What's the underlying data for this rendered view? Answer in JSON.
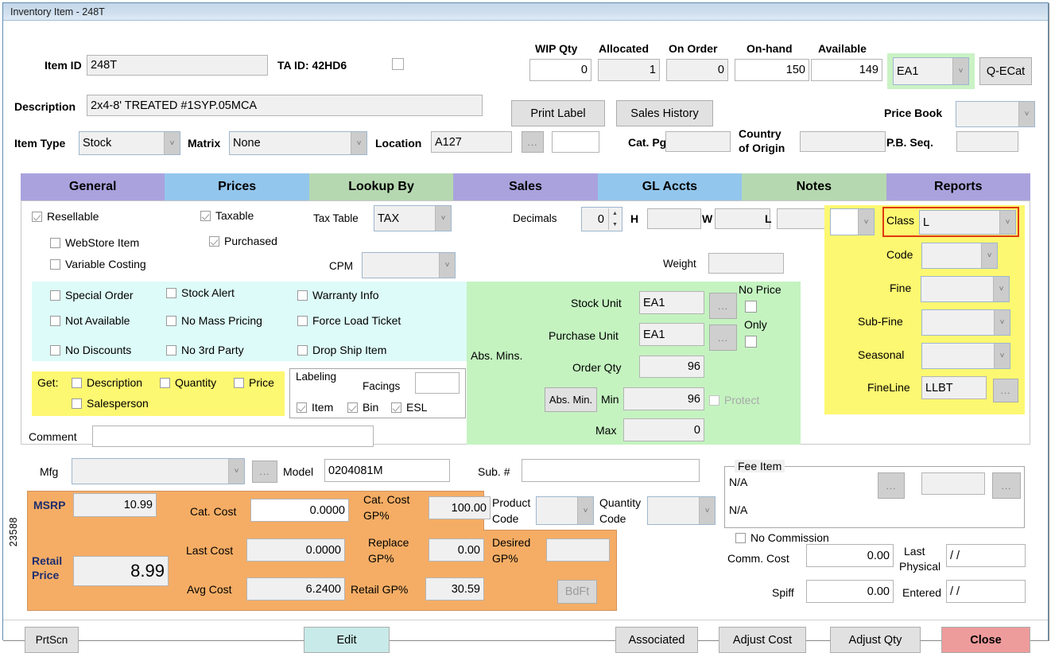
{
  "window": {
    "title": "Inventory Item - 248T",
    "record_tag": "23588"
  },
  "header": {
    "item_id_label": "Item ID",
    "item_id_value": "248T",
    "ta_id_label": "TA ID: 42HD6",
    "description_label": "Description",
    "description_value": "2x4-8' TREATED #1SYP.05MCA",
    "item_type_label": "Item Type",
    "item_type_value": "Stock",
    "matrix_label": "Matrix",
    "matrix_value": "None",
    "location_label": "Location",
    "location_value": "A127",
    "ellipsis_label": "...",
    "extra_value": "",
    "cat_pg_label": "Cat. Pg.",
    "cat_pg_value": "",
    "country_label_line1": "Country",
    "country_label_line2": "of Origin",
    "country_value": "",
    "price_book_label": "Price Book",
    "price_book_value": "",
    "pb_seq_label": "P.B. Seq.",
    "pb_seq_value": ""
  },
  "quantities": [
    {
      "label": "WIP Qty",
      "value": "0",
      "editable": true
    },
    {
      "label": "Allocated",
      "value": "1",
      "editable": false
    },
    {
      "label": "On Order",
      "value": "0",
      "editable": false
    },
    {
      "label": "On-hand",
      "value": "150",
      "editable": false
    },
    {
      "label": "Available",
      "value": "149",
      "editable": false
    }
  ],
  "unit_selector": {
    "value": "EA1"
  },
  "buttons": {
    "qecat": "Q-ECat",
    "print_label": "Print Label",
    "sales_history": "Sales History",
    "prtscn": "PrtScn",
    "edit": "Edit",
    "associated": "Associated",
    "adjust_cost": "Adjust Cost",
    "adjust_qty": "Adjust Qty",
    "close": "Close",
    "abs_min": "Abs. Min.",
    "bdft": "BdFt",
    "ellipsis": "..."
  },
  "tabs": [
    {
      "label": "General",
      "color": "purple",
      "active": true
    },
    {
      "label": "Prices",
      "color": "blue",
      "active": false
    },
    {
      "label": "Lookup By",
      "color": "green",
      "active": false
    },
    {
      "label": "Sales",
      "color": "purple",
      "active": false
    },
    {
      "label": "GL Accts",
      "color": "blue",
      "active": false
    },
    {
      "label": "Notes",
      "color": "green",
      "active": false
    },
    {
      "label": "Reports",
      "color": "purple",
      "active": false
    }
  ],
  "general": {
    "resellable": {
      "label": "Resellable",
      "checked": true
    },
    "webstore_item": {
      "label": "WebStore Item",
      "checked": false
    },
    "variable_costing": {
      "label": "Variable Costing",
      "checked": false
    },
    "taxable": {
      "label": "Taxable",
      "checked": true
    },
    "purchased": {
      "label": "Purchased",
      "checked": true
    },
    "tax_table_label": "Tax Table",
    "tax_table_value": "TAX",
    "cpm_label": "CPM",
    "cpm_value": "",
    "decimals_label": "Decimals",
    "decimals_value": "0",
    "h_label": "H",
    "h_value": "",
    "w_label": "W",
    "w_value": "",
    "l_label": "L",
    "l_value": "",
    "weight_label": "Weight",
    "weight_value": ""
  },
  "flags_panel": [
    {
      "label": "Special Order",
      "checked": false
    },
    {
      "label": "Stock Alert",
      "checked": false
    },
    {
      "label": "Warranty Info",
      "checked": false
    },
    {
      "label": "Not Available",
      "checked": false
    },
    {
      "label": "No Mass Pricing",
      "checked": false
    },
    {
      "label": "Force Load Ticket",
      "checked": false
    },
    {
      "label": "No Discounts",
      "checked": false
    },
    {
      "label": "No 3rd Party",
      "checked": false
    },
    {
      "label": "Drop Ship Item",
      "checked": false
    }
  ],
  "get_panel": {
    "title": "Get:",
    "items": [
      {
        "label": "Description",
        "checked": false
      },
      {
        "label": "Quantity",
        "checked": false
      },
      {
        "label": "Price",
        "checked": false
      },
      {
        "label": "Salesperson",
        "checked": false
      }
    ]
  },
  "labeling": {
    "caption": "Labeling",
    "facings_label": "Facings",
    "facings_value": "",
    "item": {
      "label": "Item",
      "checked": true
    },
    "bin": {
      "label": "Bin",
      "checked": true
    },
    "esl": {
      "label": "ESL",
      "checked": true
    }
  },
  "comment": {
    "label": "Comment",
    "value": ""
  },
  "units": {
    "abs_mins_label": "Abs. Mins.",
    "stock_unit_label": "Stock Unit",
    "stock_unit_value": "EA1",
    "purchase_unit_label": "Purchase Unit",
    "purchase_unit_value": "EA1",
    "order_qty_label": "Order Qty",
    "order_qty_value": "96",
    "min_label": "Min",
    "min_value": "96",
    "max_label": "Max",
    "max_value": "0",
    "no_price": {
      "label": "No Price",
      "checked": false
    },
    "only": {
      "label": "Only",
      "checked": false
    },
    "protect": {
      "label": "Protect",
      "checked": false,
      "disabled": true
    }
  },
  "classification": {
    "unnamed_value": "",
    "class_label": "Class",
    "class_value": "L",
    "code_label": "Code",
    "code_value": "",
    "fine_label": "Fine",
    "fine_value": "",
    "subfine_label": "Sub-Fine",
    "subfine_value": "",
    "seasonal_label": "Seasonal",
    "seasonal_value": "",
    "fineline_label": "FineLine",
    "fineline_value": "LLBT"
  },
  "mfg_row": {
    "mfg_label": "Mfg",
    "mfg_value": "",
    "model_label": "Model",
    "model_value": "0204081M",
    "sub_label": "Sub. #",
    "sub_value": ""
  },
  "pricing": {
    "msrp_label": "MSRP",
    "msrp_value": "10.99",
    "retail_price_label_1": "Retail",
    "retail_price_label_2": "Price",
    "retail_price_value": "8.99",
    "cat_cost_label": "Cat. Cost",
    "cat_cost_value": "0.0000",
    "last_cost_label": "Last Cost",
    "last_cost_value": "0.0000",
    "avg_cost_label": "Avg Cost",
    "avg_cost_value": "6.2400",
    "cat_cost_gp_label_1": "Cat. Cost",
    "cat_cost_gp_label_2": "GP%",
    "cat_cost_gp_value": "100.00",
    "replace_gp_label_1": "Replace",
    "replace_gp_label_2": "GP%",
    "replace_gp_value": "0.00",
    "retail_gp_label": "Retail GP%",
    "retail_gp_value": "30.59",
    "desired_gp_label_1": "Desired",
    "desired_gp_label_2": "GP%",
    "desired_gp_value": "",
    "product_code_label_1": "Product",
    "product_code_label_2": "Code",
    "product_code_value": "",
    "quantity_code_label_1": "Quantity",
    "quantity_code_label_2": "Code",
    "quantity_code_value": ""
  },
  "fee_item": {
    "caption": "Fee Item",
    "line1": "N/A",
    "line2": "N/A",
    "field_value": "",
    "no_commission": {
      "label": "No Commission",
      "checked": false
    },
    "comm_cost_label": "Comm. Cost",
    "comm_cost_value": "0.00",
    "spiff_label": "Spiff",
    "spiff_value": "0.00",
    "last_physical_label_1": "Last",
    "last_physical_label_2": "Physical",
    "last_physical_value": "/  /",
    "entered_label": "Entered",
    "entered_value": "/  /"
  },
  "colors": {
    "tab_purple": "#aaa2dd",
    "tab_blue": "#93c6ec",
    "tab_green": "#b5d8b0",
    "flags_cyan": "#ddfbf8",
    "get_yellow": "#fdf871",
    "units_green": "#c4f3c0",
    "class_yellow": "#fdf871",
    "pricing_orange": "#f5ad65",
    "highlight_green": "#caf2c4",
    "highlight_red": "#e03a10",
    "close_red": "#ee9b9b",
    "edit_teal": "#c8eae8"
  }
}
